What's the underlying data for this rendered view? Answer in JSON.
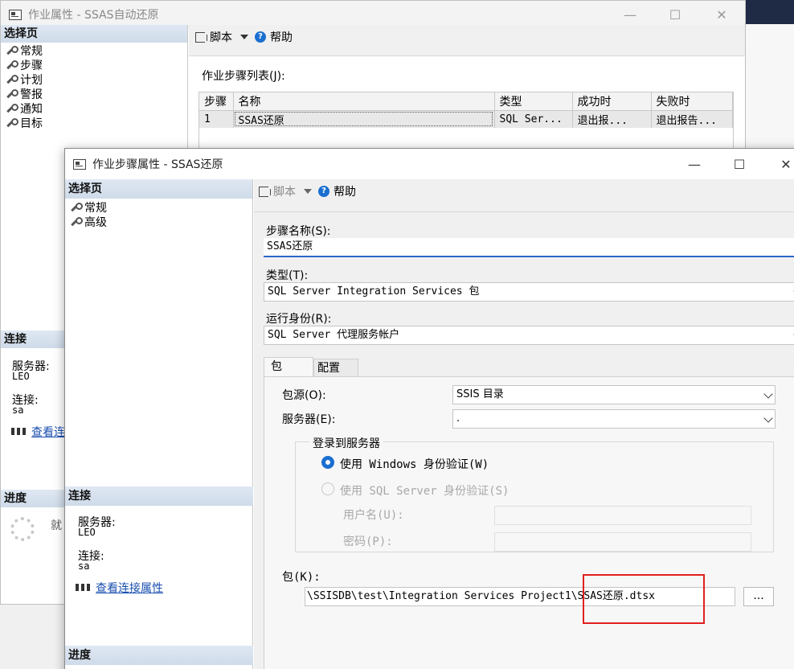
{
  "job_window": {
    "title": "作业属性 - SSAS自动还原",
    "select_page_header": "选择页",
    "pages": [
      "常规",
      "步骤",
      "计划",
      "警报",
      "通知",
      "目标"
    ],
    "toolbar": {
      "script": "脚本",
      "help": "帮助"
    },
    "steps_list_label": "作业步骤列表(J):",
    "steps_table": {
      "headers": [
        "步骤",
        "名称",
        "类型",
        "成功时",
        "失败时"
      ],
      "rows": [
        [
          "1",
          "SSAS还原",
          "SQL Ser...",
          "退出报...",
          "退出报告..."
        ]
      ]
    },
    "connection": {
      "header": "连接",
      "server_label": "服务器:",
      "server_value": "LEO",
      "conn_label": "连接:",
      "conn_value": "sa",
      "view_link": "查看连"
    },
    "progress": {
      "header": "进度",
      "status": "就"
    }
  },
  "step_window": {
    "title": "作业步骤属性 - SSAS还原",
    "select_page_header": "选择页",
    "pages": [
      "常规",
      "高级"
    ],
    "toolbar": {
      "script": "脚本",
      "help": "帮助"
    },
    "connection": {
      "header": "连接",
      "server_label": "服务器:",
      "server_value": "LEO",
      "conn_label": "连接:",
      "conn_value": "sa",
      "view_link": "查看连接属性"
    },
    "progress": {
      "header": "进度"
    },
    "form": {
      "step_name_label": "步骤名称(S):",
      "step_name_value": "SSAS还原",
      "type_label": "类型(T):",
      "type_value": "SQL Server Integration Services 包",
      "run_as_label": "运行身份(R):",
      "run_as_value": "SQL Server 代理服务帐户",
      "tabs": [
        "包",
        "配置"
      ],
      "package_source_label": "包源(O):",
      "package_source_value": "SSIS 目录",
      "server_label": "服务器(E):",
      "server_value": ".",
      "login_group_label": "登录到服务器",
      "windows_auth_label": "使用 Windows 身份验证(W)",
      "sql_auth_label": "使用 SQL Server 身份验证(S)",
      "username_label": "用户名(U):",
      "password_label": "密码(P):",
      "package_label": "包(K):",
      "package_value": "\\SSISDB\\test\\Integration Services Project1\\SSAS还原.dtsx",
      "browse_label": "..."
    }
  },
  "colors": {
    "highlight_box": "#e02020",
    "radio_selected": "#1a6fd0",
    "link": "#1a4fb0"
  }
}
